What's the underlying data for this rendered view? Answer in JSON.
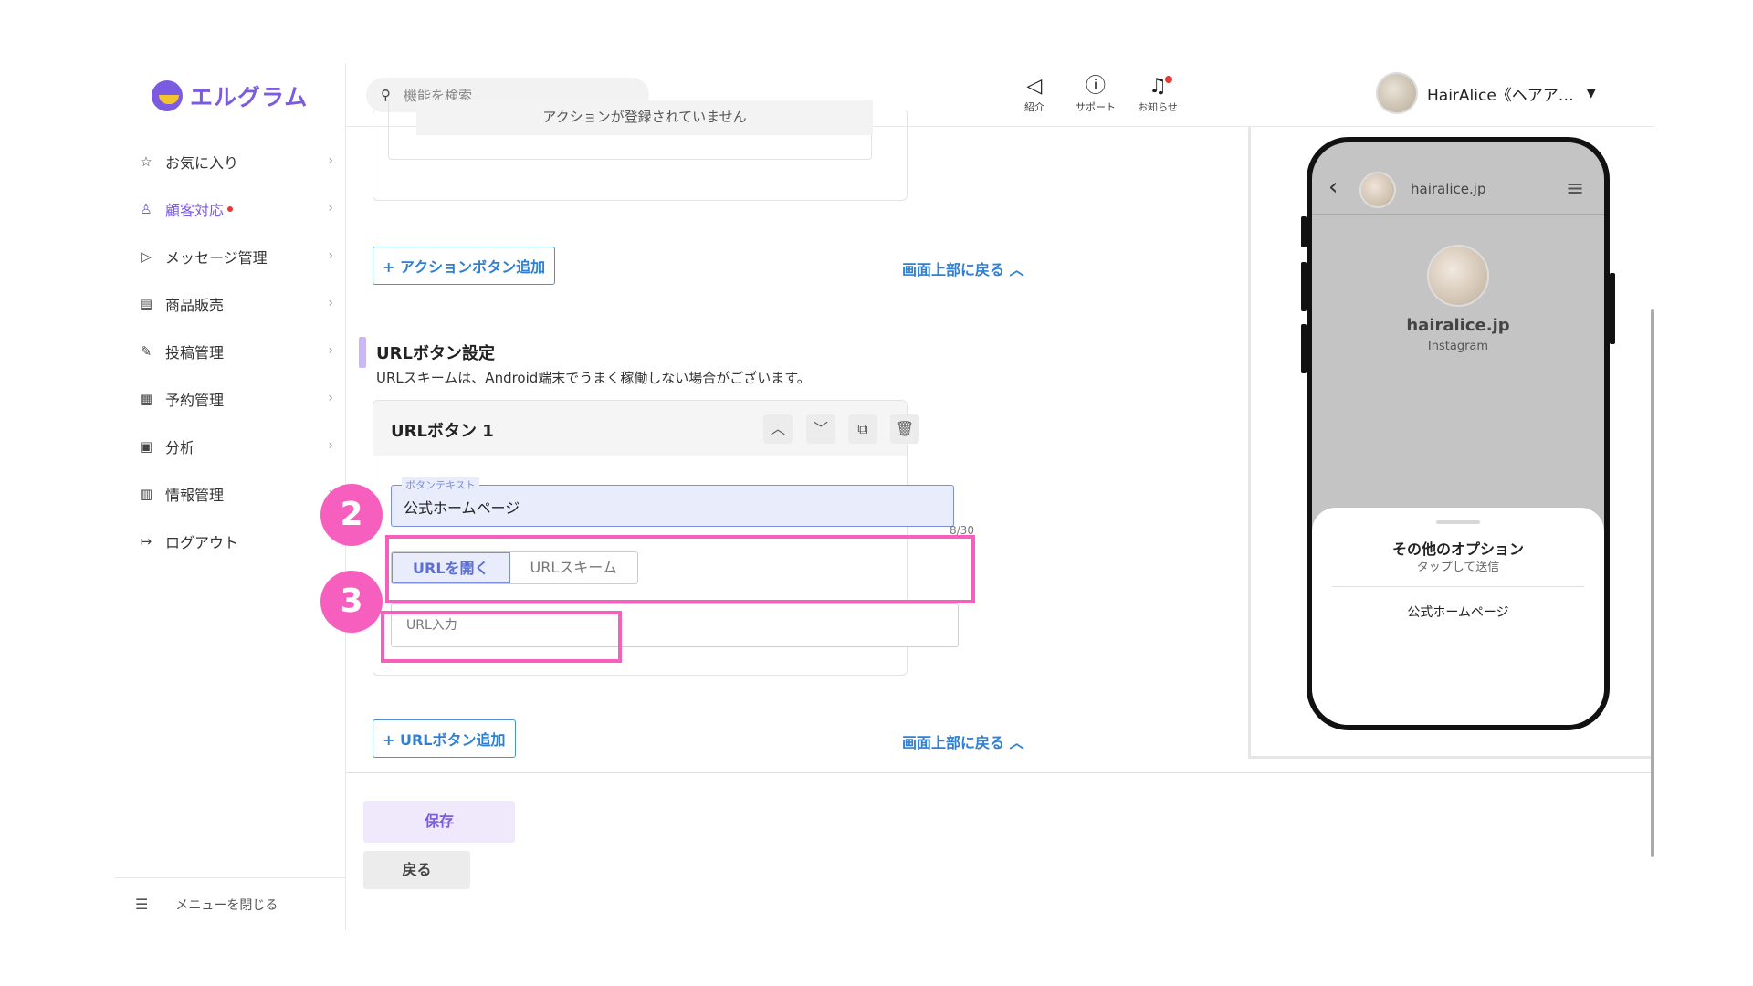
{
  "app": {
    "logo_text": "エルグラム",
    "brand_color": "#7b5ce0"
  },
  "sidebar": {
    "items": [
      {
        "label": "お気に入り",
        "icon": "star-icon"
      },
      {
        "label": "顧客対応",
        "icon": "person-icon",
        "active": true
      },
      {
        "label": "メッセージ管理",
        "icon": "send-icon"
      },
      {
        "label": "商品販売",
        "icon": "store-icon"
      },
      {
        "label": "投稿管理",
        "icon": "edit-icon"
      },
      {
        "label": "予約管理",
        "icon": "calendar-icon"
      },
      {
        "label": "分析",
        "icon": "report-icon"
      },
      {
        "label": "情報管理",
        "icon": "chart-icon"
      },
      {
        "label": "ログアウト",
        "icon": "logout-icon"
      }
    ],
    "footer_label": "メニューを閉じる"
  },
  "topbar": {
    "search_placeholder": "機能を検索",
    "icons": [
      {
        "label": "紹介",
        "icon": "megaphone-icon"
      },
      {
        "label": "サポート",
        "icon": "help-icon"
      },
      {
        "label": "お知らせ",
        "icon": "bell-icon"
      }
    ],
    "user_name": "HairAlice《ヘアア…"
  },
  "main": {
    "empty_message": "アクションが登録されていません",
    "add_action_button": "+ アクションボタン追加",
    "back_to_top": "画面上部に戻る ︿",
    "section_title": "URLボタン設定",
    "section_desc": "URLスキームは、Android端末でうまく稼働しない場合がございます。",
    "url_card": {
      "title": "URLボタン 1",
      "field_label": "ボタンテキスト",
      "field_value": "公式ホームページ",
      "counter": "8/30",
      "toggle_open": "URLを開く",
      "toggle_scheme": "URLスキーム",
      "url_placeholder": "URL入力"
    },
    "add_url_button": "+ URLボタン追加",
    "save_button": "保存",
    "back_button": "戻る"
  },
  "callouts": {
    "step2": "2",
    "step3": "3",
    "highlight_color": "#f75fbf"
  },
  "preview": {
    "account": "hairalice.jp",
    "profile_name": "hairalice.jp",
    "profile_sub": "Instagram",
    "sheet_title": "その他のオプション",
    "sheet_sub": "タップして送信",
    "sheet_item": "公式ホームページ"
  }
}
